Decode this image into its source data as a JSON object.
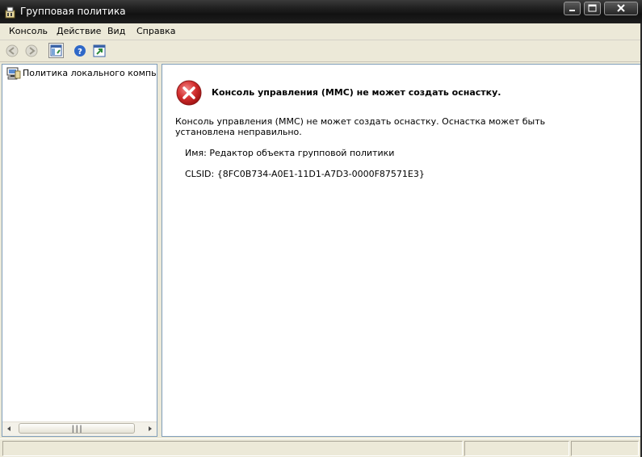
{
  "window": {
    "title": "Групповая политика",
    "icon": "group-policy-icon",
    "controls": [
      "minimize-icon",
      "maximize-icon",
      "close-icon"
    ]
  },
  "menu": {
    "items": [
      {
        "label": "Консоль"
      },
      {
        "label": "Действие"
      },
      {
        "label": "Вид"
      },
      {
        "label": "Справка"
      }
    ]
  },
  "toolbar": {
    "buttons": [
      {
        "icon": "back-arrow-icon",
        "enabled": false
      },
      {
        "icon": "forward-arrow-icon",
        "enabled": false
      },
      {
        "icon": "show-hide-tree-icon",
        "enabled": true
      },
      {
        "icon": "help-icon",
        "enabled": true
      },
      {
        "icon": "new-window-icon",
        "enabled": true
      }
    ]
  },
  "tree": {
    "root": {
      "label": "Политика локального компьютера",
      "icon": "local-computer-policy-icon"
    }
  },
  "error": {
    "icon": "error-icon",
    "title": "Консоль управления (MMC) не может создать оснастку.",
    "message": "Консоль управления (MMC) не может создать оснастку. Оснастка может быть установлена неправильно.",
    "name_line": "Имя: Редактор объекта групповой политики",
    "clsid_line": "CLSID: {8FC0B734-A0E1-11D1-A7D3-0000F87571E3}"
  },
  "statusbar": {
    "cells": [
      "",
      "",
      ""
    ]
  },
  "colors": {
    "titlebar": "#1e1e1e",
    "error_red": "#d22d2d",
    "pane_border": "#7f9db9",
    "chrome": "#ece9d8"
  }
}
